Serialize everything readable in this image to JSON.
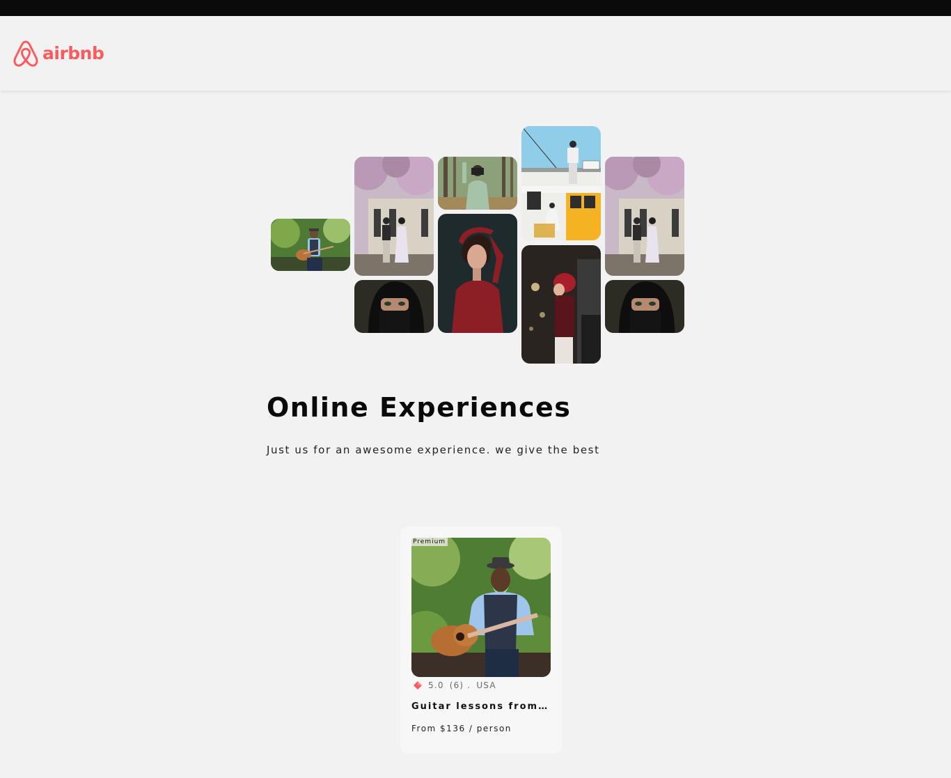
{
  "brand": {
    "name": "airbnb",
    "color": "#ff5a5f",
    "icon": "airbnb-logo-icon"
  },
  "gallery": {
    "photos": [
      {
        "name": "guitar-man-photo"
      },
      {
        "name": "couple-under-trees-photo"
      },
      {
        "name": "photographer-in-forest-photo"
      },
      {
        "name": "man-on-yellow-tram-photo"
      },
      {
        "name": "couple-under-trees-photo-2"
      },
      {
        "name": "woman-in-red-portrait-photo"
      },
      {
        "name": "woman-in-hijab-photo"
      },
      {
        "name": "woman-red-beret-night-photo"
      },
      {
        "name": "woman-in-hijab-photo-2"
      }
    ]
  },
  "hero": {
    "title": "Online Experiences",
    "subtitle": "Just us for an awesome experience. we give the best"
  },
  "cards": [
    {
      "badge": "Premium",
      "rating": "5.0",
      "reviews": "(6) .",
      "location": "USA",
      "title": "Guitar lessons from Norman",
      "price": "From $136 / person",
      "rating_icon": "star-icon",
      "rating_icon_color": "#ff5a5f"
    }
  ]
}
